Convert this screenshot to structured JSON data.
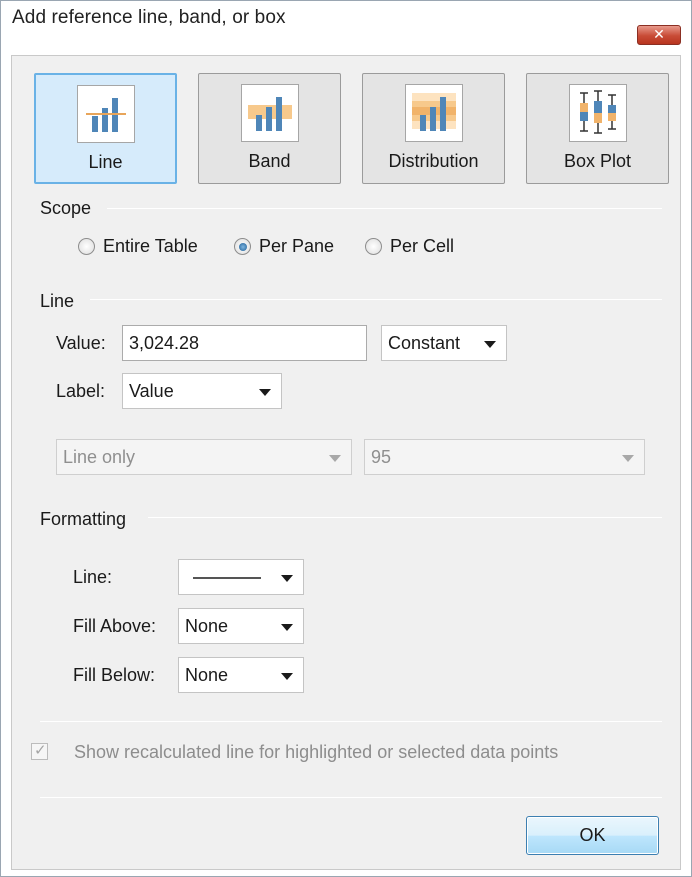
{
  "dialog": {
    "title": "Add reference line, band, or box",
    "close_glyph": "✕"
  },
  "types": [
    {
      "label": "Line",
      "icon": "reference-line-icon",
      "selected": true
    },
    {
      "label": "Band",
      "icon": "reference-band-icon",
      "selected": false
    },
    {
      "label": "Distribution",
      "icon": "distribution-icon",
      "selected": false
    },
    {
      "label": "Box Plot",
      "icon": "box-plot-icon",
      "selected": false
    }
  ],
  "scope": {
    "heading": "Scope",
    "options": [
      "Entire Table",
      "Per Pane",
      "Per Cell"
    ],
    "selected": "Per Pane"
  },
  "line_section": {
    "heading": "Line",
    "value_label": "Value:",
    "value": "3,024.28",
    "value_type": "Constant",
    "label_label": "Label:",
    "label_value": "Value",
    "confidence_band": "Line only",
    "confidence_level": "95"
  },
  "formatting": {
    "heading": "Formatting",
    "line_label": "Line:",
    "fill_above_label": "Fill Above:",
    "fill_above_value": "None",
    "fill_below_label": "Fill Below:",
    "fill_below_value": "None"
  },
  "recalc": {
    "label": "Show recalculated line for highlighted or selected data points",
    "checked": true,
    "enabled": false
  },
  "buttons": {
    "ok": "OK"
  },
  "colors": {
    "selected_bg": "#d6ebfb",
    "selected_border": "#6ab2e6",
    "bar_blue": "#4f86b8",
    "band_orange": "#f7c98c",
    "line_orange": "#e8a55a"
  }
}
